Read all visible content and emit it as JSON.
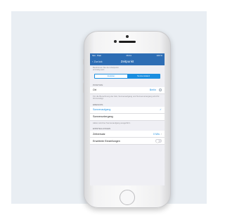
{
  "status_bar": {
    "carrier": "Sim. Paar",
    "time": "09:41",
    "battery": "100 %"
  },
  "nav": {
    "back_label": "Zurück",
    "title": "Zeitpunkt"
  },
  "intro": {
    "line1": "Bestimmen Sie den Zeitpunkt",
    "line2": "einmalig sein"
  },
  "segment": {
    "options": [
      "Zeitplan",
      "Sonnenstand"
    ],
    "selected": "Sonnenstand"
  },
  "position": {
    "header": "Position",
    "row_label": "Ort",
    "row_value": "Berlin",
    "note": "Für die Berechnung der Zeit, Sonnenaufgang und Sonnenuntergang wird Ihr Ort benötigt."
  },
  "ereignis": {
    "header": "Ereignis",
    "options": [
      "Sonnenaufgang",
      "Sonnenuntergang"
    ],
    "selected": "Sonnenaufgang",
    "note": "Aktion wird bei Sonnenaufgang ausgeführt."
  },
  "einstellungen": {
    "header": "Einstellungen",
    "zeitversatz_label": "Zeitversatz",
    "zeitversatz_value": "0 Min.",
    "erweitert_label": "Erweiterte Einstellungen",
    "erweitert_on": false
  },
  "colors": {
    "nav_blue": "#2d6db4",
    "accent": "#1b8ee0",
    "background": "#e9eef3"
  }
}
